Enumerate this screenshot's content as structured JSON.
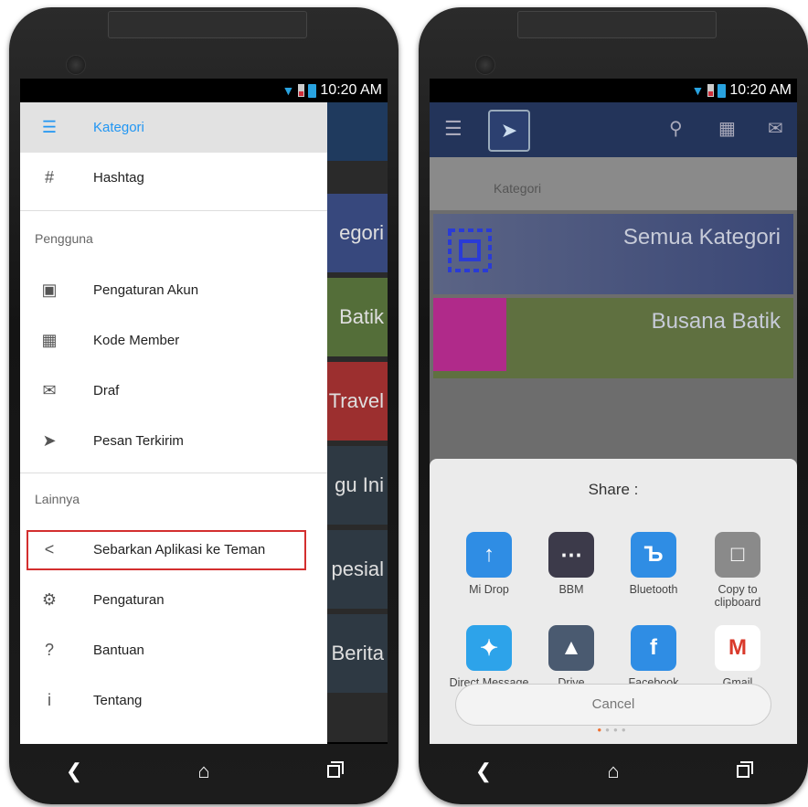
{
  "status": {
    "time": "10:20 AM"
  },
  "drawer": {
    "items_top": [
      {
        "label": "Kategori",
        "icon": "list-icon"
      },
      {
        "label": "Hashtag",
        "icon": "hashtag-icon"
      }
    ],
    "section_pengguna": "Pengguna",
    "items_user": [
      {
        "label": "Pengaturan Akun",
        "icon": "account-icon"
      },
      {
        "label": "Kode Member",
        "icon": "member-card-icon"
      },
      {
        "label": "Draf",
        "icon": "draft-icon"
      },
      {
        "label": "Pesan Terkirim",
        "icon": "sent-icon"
      }
    ],
    "section_lainnya": "Lainnya",
    "items_other": [
      {
        "label": "Sebarkan Aplikasi ke Teman",
        "icon": "share-icon"
      },
      {
        "label": "Pengaturan",
        "icon": "gear-icon"
      },
      {
        "label": "Bantuan",
        "icon": "help-icon"
      },
      {
        "label": "Tentang",
        "icon": "info-icon"
      }
    ]
  },
  "left_bg_tiles": [
    "egori",
    "Batik",
    "Travel",
    "gu Ini",
    "pesial",
    "Berita"
  ],
  "right": {
    "kategori_label": "Kategori",
    "tiles": [
      "Semua Kategori",
      "Busana Batik"
    ],
    "share_title": "Share :",
    "share_targets": [
      {
        "label": "Mi Drop",
        "color": "#2f8de4"
      },
      {
        "label": "BBM",
        "color": "#3c3a4a"
      },
      {
        "label": "Bluetooth",
        "color": "#2f8de4"
      },
      {
        "label": "Copy to clipboard",
        "color": "#8a8a8a"
      },
      {
        "label": "Direct Message",
        "color": "#2da3ea"
      },
      {
        "label": "Drive",
        "color": "#4a5a70"
      },
      {
        "label": "Facebook",
        "color": "#2f8de4"
      },
      {
        "label": "Gmail",
        "color": "#ffffff"
      }
    ],
    "cancel_label": "Cancel"
  },
  "colors": {
    "accent": "#2196f3",
    "highlight": "#d32f2f",
    "appbar": "#23345a"
  }
}
